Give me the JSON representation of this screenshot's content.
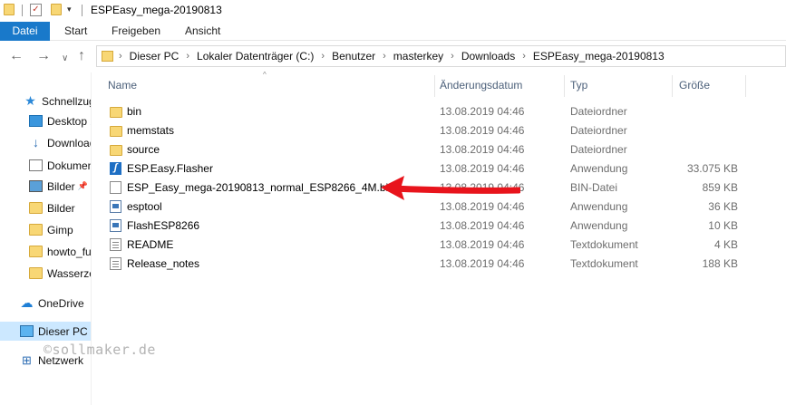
{
  "window": {
    "title": "ESPEasy_mega-20190813"
  },
  "ribbon": {
    "tabs": [
      "Datei",
      "Start",
      "Freigeben",
      "Ansicht"
    ]
  },
  "address": {
    "crumbs": [
      "Dieser PC",
      "Lokaler Datenträger (C:)",
      "Benutzer",
      "masterkey",
      "Downloads",
      "ESPEasy_mega-20190813"
    ]
  },
  "sidebar": {
    "items": [
      {
        "label": "Schnellzugriff",
        "icon": "star-icon"
      },
      {
        "label": "Desktop",
        "icon": "desktop-icon",
        "pinned": true
      },
      {
        "label": "Downloads",
        "icon": "download-icon",
        "pinned": true
      },
      {
        "label": "Dokumente",
        "icon": "document-icon",
        "pinned": true
      },
      {
        "label": "Bilder",
        "icon": "pictures-icon",
        "pinned": true
      },
      {
        "label": "Bilder",
        "icon": "folder-icon"
      },
      {
        "label": "Gimp",
        "icon": "folder-icon"
      },
      {
        "label": "howto_fu",
        "icon": "folder-icon"
      },
      {
        "label": "Wasserzeichen",
        "icon": "folder-icon"
      },
      {
        "label": "OneDrive",
        "icon": "cloud-icon"
      },
      {
        "label": "Dieser PC",
        "icon": "computer-icon"
      },
      {
        "label": "Netzwerk",
        "icon": "network-icon"
      }
    ]
  },
  "columns": {
    "name": "Name",
    "date": "Änderungsdatum",
    "type": "Typ",
    "size": "Größe"
  },
  "files": [
    {
      "name": "bin",
      "date": "13.08.2019 04:46",
      "type": "Dateiordner",
      "size": "",
      "icon": "folder-icon"
    },
    {
      "name": "memstats",
      "date": "13.08.2019 04:46",
      "type": "Dateiordner",
      "size": "",
      "icon": "folder-icon"
    },
    {
      "name": "source",
      "date": "13.08.2019 04:46",
      "type": "Dateiordner",
      "size": "",
      "icon": "folder-icon"
    },
    {
      "name": "ESP.Easy.Flasher",
      "date": "13.08.2019 04:46",
      "type": "Anwendung",
      "size": "33.075 KB",
      "icon": "flasher-app-icon"
    },
    {
      "name": "ESP_Easy_mega-20190813_normal_ESP8266_4M.bin",
      "date": "13.08.2019 04:46",
      "type": "BIN-Datei",
      "size": "859 KB",
      "icon": "file-icon"
    },
    {
      "name": "esptool",
      "date": "13.08.2019 04:46",
      "type": "Anwendung",
      "size": "36 KB",
      "icon": "app-icon"
    },
    {
      "name": "FlashESP8266",
      "date": "13.08.2019 04:46",
      "type": "Anwendung",
      "size": "10 KB",
      "icon": "app-icon"
    },
    {
      "name": "README",
      "date": "13.08.2019 04:46",
      "type": "Textdokument",
      "size": "4 KB",
      "icon": "text-file-icon"
    },
    {
      "name": "Release_notes",
      "date": "13.08.2019 04:46",
      "type": "Textdokument",
      "size": "188 KB",
      "icon": "text-file-icon"
    }
  ],
  "watermark": "©sollmaker.de",
  "colors": {
    "accent": "#1979ca",
    "arrow": "#e8141c",
    "selection": "#cce8ff"
  }
}
